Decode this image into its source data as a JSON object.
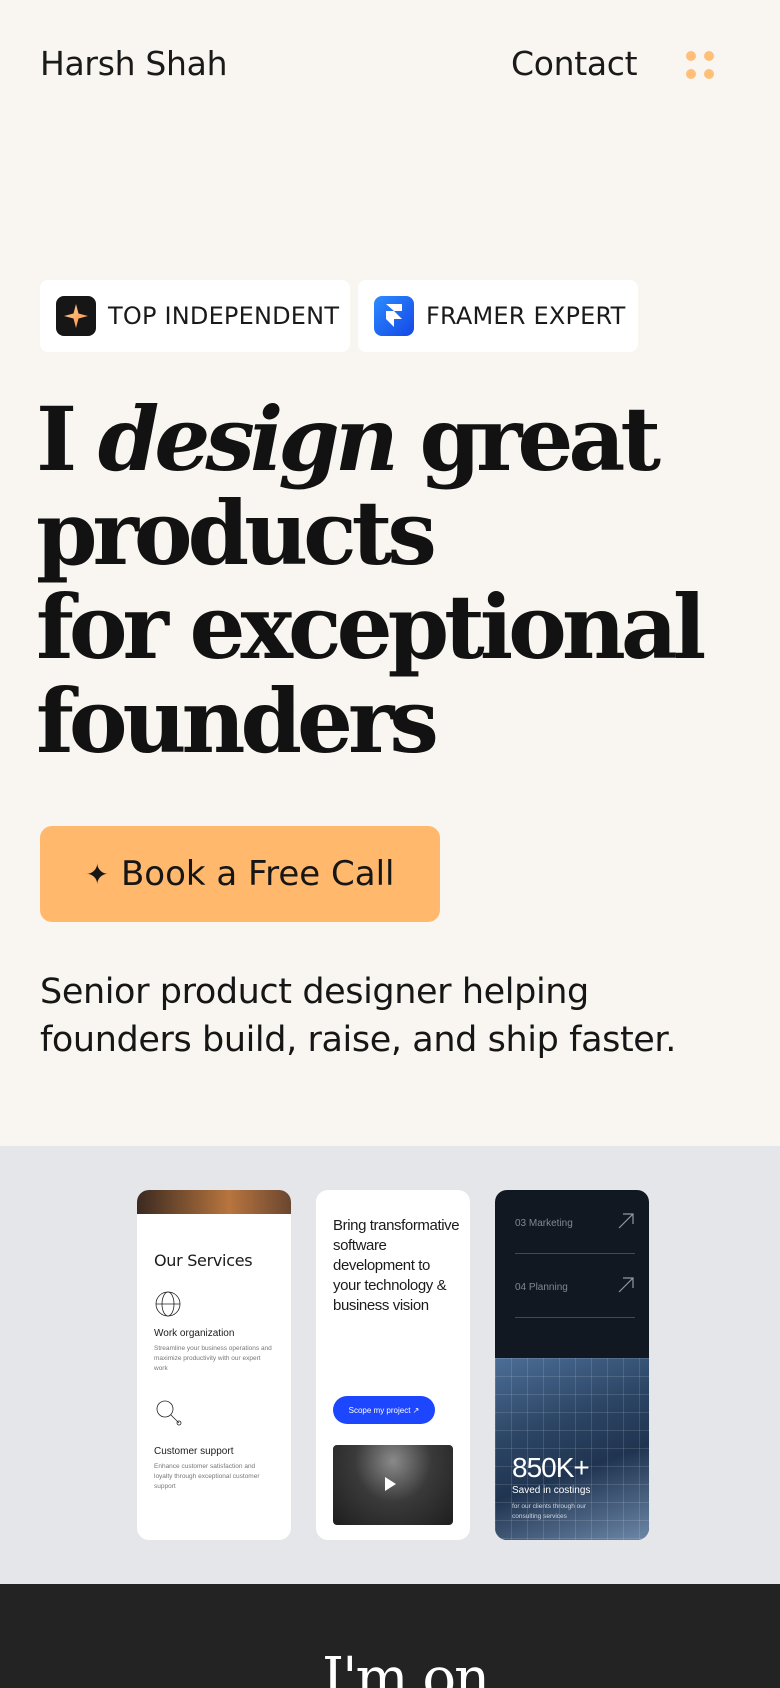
{
  "header": {
    "brand": "Harsh Shah",
    "contact_label": "Contact",
    "menu_icon": "grid-dots-icon",
    "accent_color": "#ffbf78"
  },
  "badges": [
    {
      "label": "TOP INDEPENDENT",
      "icon": "sparkle-star-icon"
    },
    {
      "label": "FRAMER EXPERT",
      "icon": "framer-logo-icon"
    }
  ],
  "hero": {
    "line1_a": "I ",
    "line1_em": "design",
    "line1_b": " great",
    "line2": "products",
    "line3": "for exceptional",
    "line4": "founders",
    "cta_icon": "✦",
    "cta_label": "Book a Free Call",
    "cta_color": "#ffb86c",
    "subtitle_line1": "Senior product designer helping",
    "subtitle_line2": "founders build, raise, and ship faster."
  },
  "showcase": {
    "card1": {
      "title": "Our Services",
      "services": [
        {
          "name": "Work organization",
          "desc": "Streamline your business operations and maximize productivity with our expert work"
        },
        {
          "name": "Customer support",
          "desc": "Enhance customer satisfaction and loyalty through exceptional customer support"
        }
      ]
    },
    "card2": {
      "title": "Bring transformative software development to your technology & business vision",
      "button_label": "Scope my project ↗"
    },
    "card3": {
      "rows": [
        {
          "label": "03   Marketing"
        },
        {
          "label": "04   Planning"
        }
      ],
      "stat": "850K+",
      "stat_label": "Saved in costings",
      "stat_note": "for our clients through our consulting services"
    }
  },
  "next_section": {
    "heading_peek": "I'm on"
  }
}
